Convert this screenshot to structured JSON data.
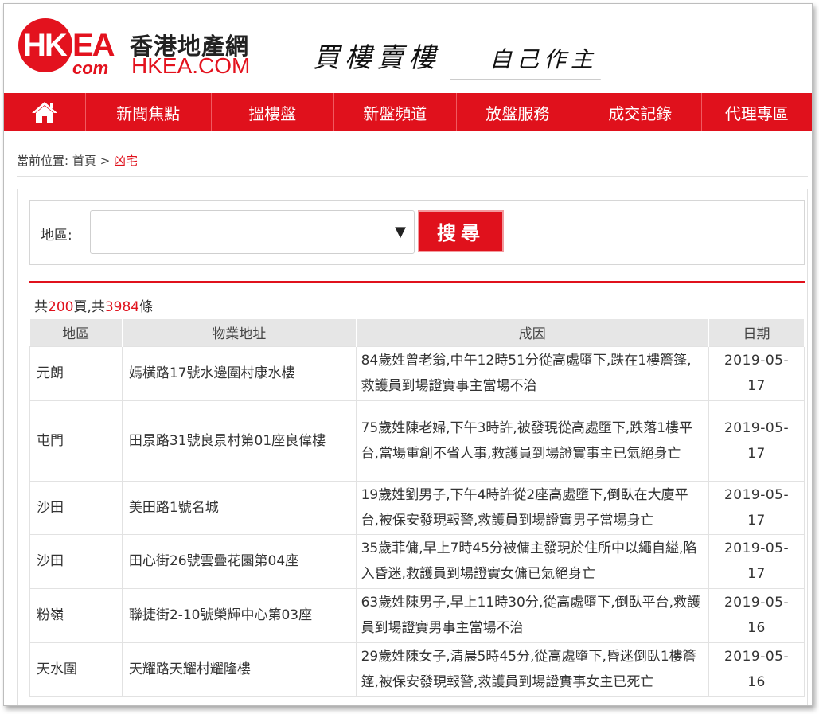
{
  "header": {
    "logo_hk": "HK",
    "logo_ea": "EA",
    "logo_com": "com",
    "site_name_cn": "香港地產網",
    "site_name_en": "HKEA.COM",
    "slogan_1": "買樓賣樓",
    "slogan_2": "自己作主"
  },
  "nav": {
    "home_icon": "home-icon",
    "items": [
      "新聞焦點",
      "搵樓盤",
      "新盤頻道",
      "放盤服務",
      "成交記錄",
      "代理專區"
    ]
  },
  "breadcrumb": {
    "prefix": "當前位置:",
    "home": "首頁",
    "separator": ">",
    "current": "凶宅"
  },
  "search": {
    "label": "地區:",
    "selected": "",
    "arrow": "▼",
    "button": "搜尋"
  },
  "summary": {
    "pre": "共",
    "pages": "200",
    "mid": "頁,共",
    "total": "3984",
    "post": "條"
  },
  "table": {
    "headers": [
      "地區",
      "物業地址",
      "成因",
      "日期"
    ],
    "rows": [
      {
        "district": "元朗",
        "address": "媽橫路17號水邊圍村康水樓",
        "cause": "84歲姓曾老翁,中午12時51分從高處墮下,跌在1樓簷篷,救護員到場證實事主當場不治",
        "date": "2019-05-17"
      },
      {
        "district": "屯門",
        "address": "田景路31號良景村第01座良偉樓",
        "cause": "75歲姓陳老婦,下午3時許,被發現從高處墮下,跌落1樓平台,當場重創不省人事,救護員到場證實事主已氣絕身亡",
        "date": "2019-05-17"
      },
      {
        "district": "沙田",
        "address": "美田路1號名城",
        "cause": "19歲姓劉男子,下午4時許從2座高處墮下,倒臥在大廈平台,被保安發現報警,救護員到場證實男子當場身亡",
        "date": "2019-05-17"
      },
      {
        "district": "沙田",
        "address": "田心街26號雲疊花園第04座",
        "cause": "35歲菲傭,早上7時45分被傭主發現於住所中以繩自縊,陷入昏迷,救護員到場證實女傭已氣絕身亡",
        "date": "2019-05-17"
      },
      {
        "district": "粉嶺",
        "address": "聯捷街2-10號榮輝中心第03座",
        "cause": "63歲姓陳男子,早上11時30分,從高處墮下,倒臥平台,救護員到場證實男事主當場不治",
        "date": "2019-05-16"
      },
      {
        "district": "天水圍",
        "address": "天耀路天耀村耀隆樓",
        "cause": "29歲姓陳女子,清晨5時45分,從高處墮下,昏迷倒臥1樓簷篷,被保安發現報警,救護員到場證實事女主已死亡",
        "date": "2019-05-16"
      }
    ]
  }
}
